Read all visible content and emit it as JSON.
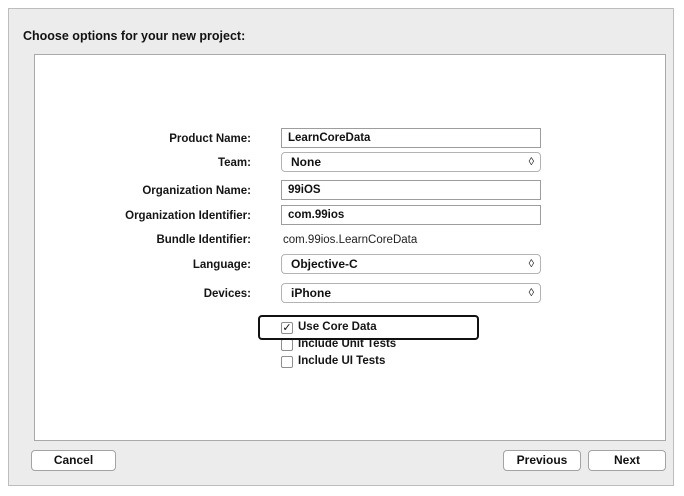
{
  "dialog": {
    "title": "Choose options for your new project:"
  },
  "form": {
    "product_name": {
      "label": "Product Name:",
      "value": "LearnCoreData"
    },
    "team": {
      "label": "Team:",
      "value": "None",
      "icon": "updown-chevron-icon"
    },
    "organization_name": {
      "label": "Organization Name:",
      "value": "99iOS"
    },
    "organization_identifier": {
      "label": "Organization Identifier:",
      "value": "com.99ios"
    },
    "bundle_identifier": {
      "label": "Bundle Identifier:",
      "value": "com.99ios.LearnCoreData"
    },
    "language": {
      "label": "Language:",
      "value": "Objective-C",
      "icon": "updown-chevron-icon"
    },
    "devices": {
      "label": "Devices:",
      "value": "iPhone",
      "icon": "updown-chevron-icon"
    },
    "checkboxes": [
      {
        "label": "Use Core Data",
        "checked": true
      },
      {
        "label": "Include Unit Tests",
        "checked": false
      },
      {
        "label": "Include UI Tests",
        "checked": false
      }
    ]
  },
  "buttons": {
    "cancel": "Cancel",
    "previous": "Previous",
    "next": "Next"
  },
  "glyphs": {
    "chevron": "◊",
    "check": "✓"
  },
  "colors": {
    "highlight_border": "#111111",
    "dialog_background": "#ececec"
  }
}
